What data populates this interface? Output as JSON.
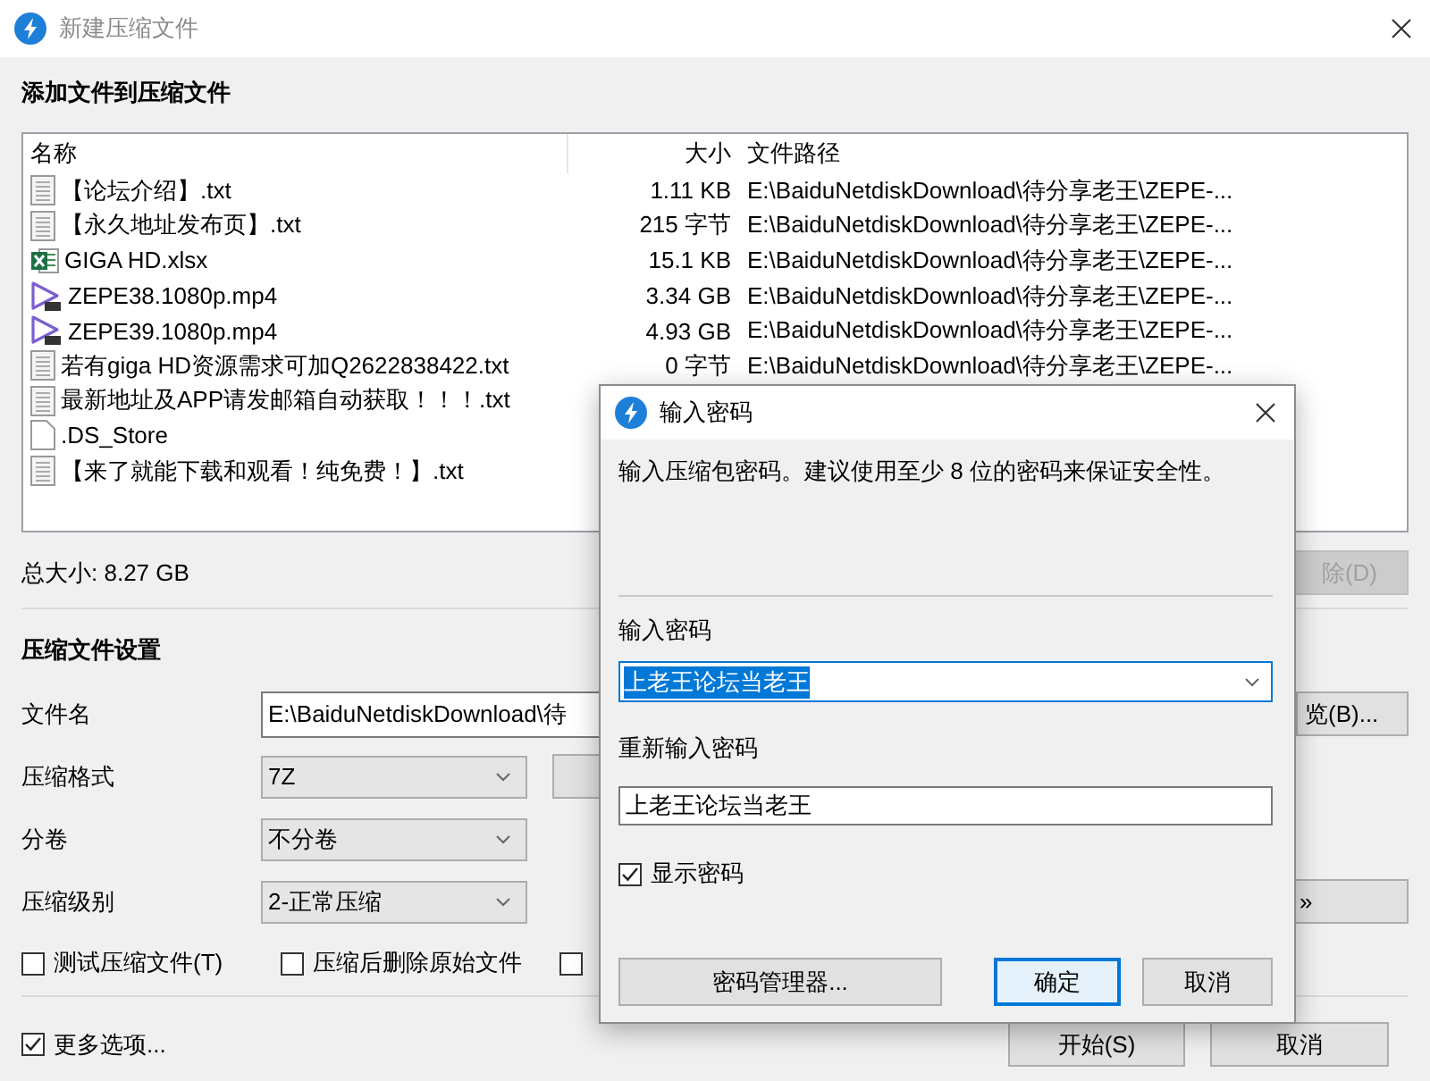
{
  "main_window": {
    "title": "新建压缩文件",
    "section_files": "添加文件到压缩文件",
    "file_list": {
      "columns": [
        "名称",
        "大小",
        "文件路径"
      ],
      "rows": [
        {
          "kind": "txt",
          "name": "【论坛介绍】.txt",
          "size": "1.11 KB",
          "path": "E:\\BaiduNetdiskDownload\\待分享老王\\ZEPE-..."
        },
        {
          "kind": "txt",
          "name": "【永久地址发布页】.txt",
          "size": "215 字节",
          "path": "E:\\BaiduNetdiskDownload\\待分享老王\\ZEPE-..."
        },
        {
          "kind": "xlsx",
          "name": "GIGA HD.xlsx",
          "size": "15.1 KB",
          "path": "E:\\BaiduNetdiskDownload\\待分享老王\\ZEPE-..."
        },
        {
          "kind": "video",
          "name": "ZEPE38.1080p.mp4",
          "size": "3.34 GB",
          "path": "E:\\BaiduNetdiskDownload\\待分享老王\\ZEPE-..."
        },
        {
          "kind": "video",
          "name": "ZEPE39.1080p.mp4",
          "size": "4.93 GB",
          "path": "E:\\BaiduNetdiskDownload\\待分享老王\\ZEPE-..."
        },
        {
          "kind": "txt",
          "name": "若有giga HD资源需求可加Q2622838422.txt",
          "size": "0 字节",
          "path": "E:\\BaiduNetdiskDownload\\待分享老王\\ZEPE-..."
        },
        {
          "kind": "txt",
          "name": "最新地址及APP请发邮箱自动获取！！！.txt"
        },
        {
          "kind": "blank",
          "name": ".DS_Store"
        },
        {
          "kind": "txt",
          "name": "【来了就能下载和观看！纯免费！】.txt"
        }
      ]
    },
    "total_size": "总大小: 8.27 GB",
    "delete_button": {
      "label": "除(D)",
      "disabled": true
    },
    "section_settings": "压缩文件设置",
    "settings": [
      {
        "kind": "field",
        "label": "文件名",
        "value": "E:\\BaiduNetdiskDownload\\待",
        "side_button": {
          "kind": "trailing",
          "label": "览(B)..."
        }
      },
      {
        "kind": "combo",
        "label": "压缩格式",
        "value": "7Z",
        "side_button": {
          "kind": "adjacent"
        }
      },
      {
        "kind": "combo",
        "label": "分卷",
        "value": "不分卷"
      },
      {
        "kind": "combo",
        "label": "压缩级别",
        "value": "2-正常压缩",
        "side_button": {
          "kind": "trailing",
          "label": "»"
        }
      }
    ],
    "options": [
      {
        "label": "测试压缩文件(T)",
        "checked": false
      },
      {
        "label": "压缩后删除原始文件",
        "checked": false
      },
      {
        "checked": false
      }
    ],
    "more_options": {
      "label": "更多选项...",
      "checked": true
    },
    "buttons": [
      "开始(S)",
      "取消"
    ]
  },
  "password_dialog": {
    "title": "输入密码",
    "message": "输入压缩包密码。建议使用至少 8 位的密码来保证安全性。",
    "password_label": "输入密码",
    "password": {
      "value": "上老王论坛当老王",
      "selected": true
    },
    "confirm_label": "重新输入密码",
    "confirm_value": "上老王论坛当老王",
    "show_password": {
      "label": "显示密码",
      "checked": true
    },
    "buttons": [
      {
        "label": "密码管理器...",
        "focused": false
      },
      {
        "label": "确定",
        "focused": true
      },
      {
        "label": "取消",
        "focused": false
      }
    ]
  }
}
